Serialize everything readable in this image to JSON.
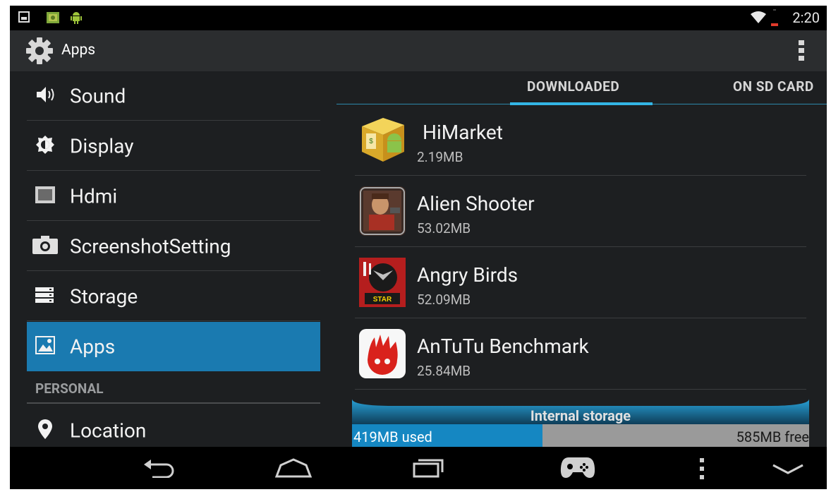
{
  "status_bar": {
    "notification_icons": [
      "gallery-icon",
      "image-icon",
      "android-icon"
    ],
    "system_icons": [
      "wifi-icon",
      "battery-low-icon"
    ],
    "time": "2:20"
  },
  "action_bar": {
    "icon": "gear-icon",
    "title": "Apps",
    "overflow_icon": "overflow-menu-icon"
  },
  "settings_list": {
    "items": [
      {
        "label": "Sound",
        "icon": "volume-icon"
      },
      {
        "label": "Display",
        "icon": "brightness-icon"
      },
      {
        "label": "Hdmi",
        "icon": "hdmi-icon"
      },
      {
        "label": "ScreenshotSetting",
        "icon": "camera-icon"
      },
      {
        "label": "Storage",
        "icon": "storage-icon"
      },
      {
        "label": "Apps",
        "icon": "apps-icon",
        "selected": true
      }
    ],
    "section_header": "PERSONAL",
    "personal_items": [
      {
        "label": "Location",
        "icon": "location-pin-icon"
      }
    ]
  },
  "tabs": [
    {
      "label": "DOWNLOADED",
      "active": true
    },
    {
      "label": "ON SD CARD",
      "active": false
    }
  ],
  "apps": [
    {
      "name": "HiMarket",
      "size": "2.19MB",
      "icon": "himarket-icon"
    },
    {
      "name": "Alien Shooter",
      "size": "53.02MB",
      "icon": "alien-shooter-icon"
    },
    {
      "name": "Angry Birds",
      "size": "52.09MB",
      "icon": "angry-birds-icon"
    },
    {
      "name": "AnTuTu Benchmark",
      "size": "25.84MB",
      "icon": "antutu-icon"
    }
  ],
  "storage": {
    "label": "Internal storage",
    "used": "419MB used",
    "free": "585MB free",
    "used_fraction": 0.417
  },
  "nav_bar": {
    "buttons": [
      "back-icon",
      "home-icon",
      "recents-icon",
      "gamepad-icon",
      "menu-icon",
      "hide-keyboard-icon"
    ]
  },
  "colors": {
    "accent": "#33b5e5",
    "selected_bg": "#1a7ab0",
    "storage_used": "#1587c2"
  }
}
